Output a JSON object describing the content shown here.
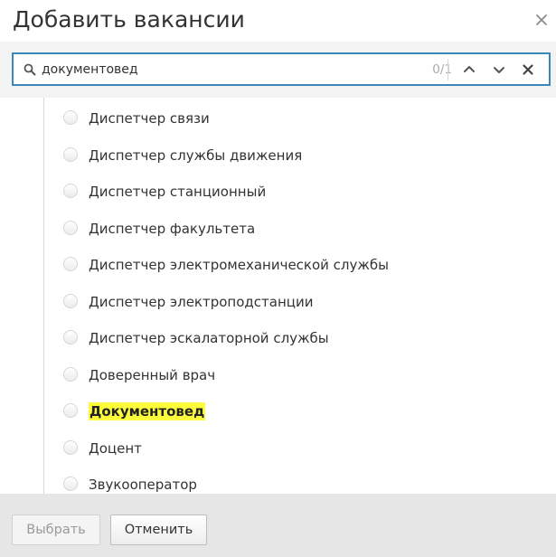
{
  "dialog": {
    "title": "Добавить вакансии",
    "close_icon": "close-icon"
  },
  "search": {
    "value": "документовед",
    "counter": "0/1",
    "icon": "search-icon",
    "prev_icon": "chevron-up-icon",
    "next_icon": "chevron-down-icon",
    "clear_icon": "close-icon",
    "border_color": "#3a87b9"
  },
  "list": {
    "items": [
      {
        "label": "Диспетчер связи",
        "highlighted": false
      },
      {
        "label": "Диспетчер службы движения",
        "highlighted": false
      },
      {
        "label": "Диспетчер станционный",
        "highlighted": false
      },
      {
        "label": "Диспетчер факультета",
        "highlighted": false
      },
      {
        "label": "Диспетчер электромеханической службы",
        "highlighted": false
      },
      {
        "label": "Диспетчер электроподстанции",
        "highlighted": false
      },
      {
        "label": "Диспетчер эскалаторной службы",
        "highlighted": false
      },
      {
        "label": "Доверенный врач",
        "highlighted": false
      },
      {
        "label": "Документовед",
        "highlighted": true
      },
      {
        "label": "Доцент",
        "highlighted": false
      },
      {
        "label": "Звукооператор",
        "highlighted": false
      }
    ],
    "highlight_color": "#fcfc3c"
  },
  "footer": {
    "select_label": "Выбрать",
    "cancel_label": "Отменить"
  }
}
